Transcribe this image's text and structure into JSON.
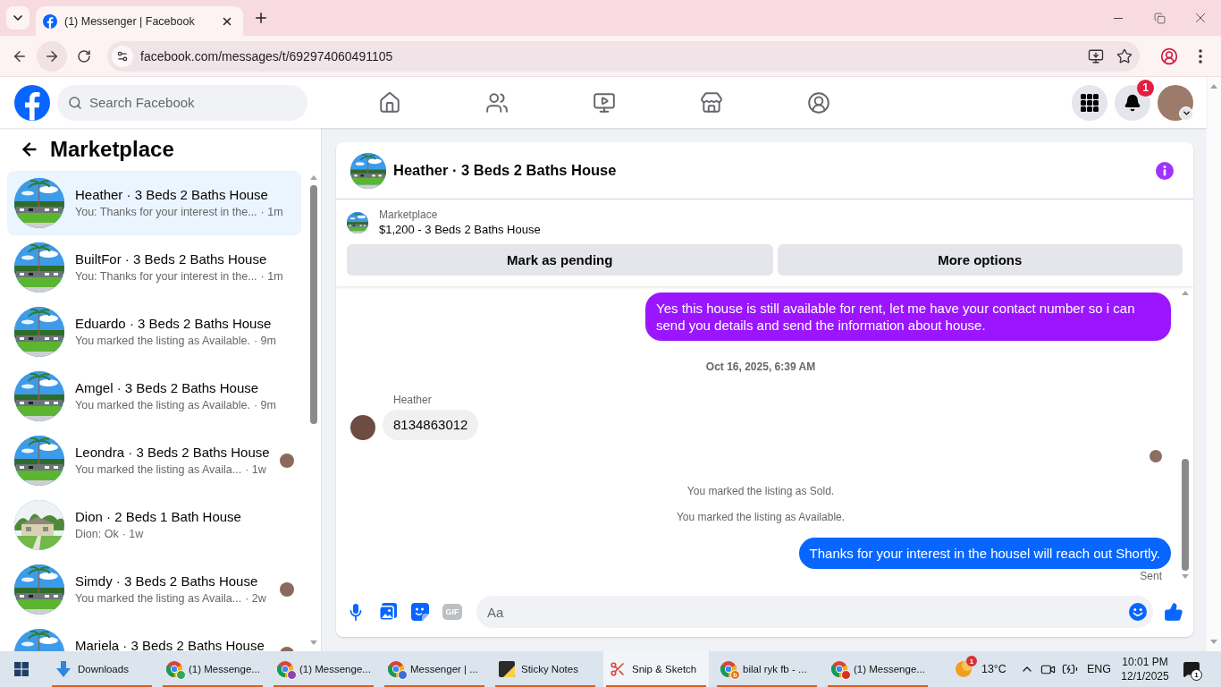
{
  "browser": {
    "tab": {
      "title": "(1) Messenger | Facebook",
      "selected": true
    },
    "address": "facebook.com/messages/t/692974060491105"
  },
  "header": {
    "search": {
      "placeholder": "Search Facebook"
    },
    "nav": [
      {
        "kind": "home",
        "selected": false
      },
      {
        "kind": "friends",
        "selected": false
      },
      {
        "kind": "video",
        "selected": false
      },
      {
        "kind": "marketplace",
        "selected": false
      },
      {
        "kind": "groups",
        "selected": false
      }
    ],
    "notifications_badge": "1"
  },
  "sidebar": {
    "title": "Marketplace",
    "conversations": [
      {
        "kind": "ranch",
        "title": "Heather · 3 Beds 2 Baths House",
        "snippet": "You: Thanks for your interest in the...",
        "time": "· 1m",
        "seen": false,
        "selected": true
      },
      {
        "kind": "ranch",
        "title": "BuiltFor · 3 Beds 2 Baths House",
        "snippet": "You: Thanks for your interest in the...",
        "time": "· 1m",
        "seen": false,
        "selected": false
      },
      {
        "kind": "ranch",
        "title": "Eduardo · 3 Beds 2 Baths House",
        "snippet": "You marked the listing as Available.",
        "time": "· 9m",
        "seen": false,
        "selected": false
      },
      {
        "kind": "ranch",
        "title": "Amgel · 3 Beds 2 Baths House",
        "snippet": "You marked the listing as Available.",
        "time": "· 9m",
        "seen": false,
        "selected": false
      },
      {
        "kind": "ranch",
        "title": "Leondra · 3 Beds 2 Baths House",
        "snippet": "You marked the listing as Availa...",
        "time": "· 1w",
        "seen": true,
        "selected": false
      },
      {
        "kind": "cottage",
        "title": "Dion · 2 Beds 1 Bath House",
        "snippet": "Dion: Ok",
        "time": "· 1w",
        "seen": false,
        "selected": false
      },
      {
        "kind": "ranch",
        "title": "Simdy · 3 Beds 2 Baths House",
        "snippet": "You marked the listing as Availa...",
        "time": "· 2w",
        "seen": true,
        "selected": false
      },
      {
        "kind": "ranch",
        "title": "Mariela · 3 Beds 2 Baths House",
        "seen": true,
        "selected": false
      }
    ]
  },
  "chat": {
    "title": "Heather · 3 Beds 2 Baths House",
    "listing": {
      "source": "Marketplace",
      "summary": "$1,200 - 3 Beds 2 Baths House"
    },
    "actions": [
      {
        "label": "Mark as pending"
      },
      {
        "label": "More options"
      }
    ],
    "messages": [
      {
        "kind": "outgoing",
        "text": "Yes this house is still available for rent, let me have your contact number so i can send you details and send the information about house.",
        "color": "#9b16fe"
      },
      {
        "kind": "timestamp",
        "text": "Oct 16, 2025, 6:39 AM"
      },
      {
        "kind": "incoming",
        "sender": "Heather",
        "text": "8134863012"
      },
      {
        "kind": "read_receipt"
      },
      {
        "kind": "event",
        "text": "You marked the listing as Sold."
      },
      {
        "kind": "event",
        "text": "You marked the listing as Available."
      },
      {
        "kind": "outgoing",
        "text": "Thanks for your interest in the housel will reach out Shortly.",
        "color": "#0866ff",
        "status": "Sent"
      }
    ],
    "composer": {
      "tools": [
        {
          "kind": "mic"
        },
        {
          "kind": "photo"
        },
        {
          "kind": "sticker"
        },
        {
          "kind": "gif",
          "label": "GIF"
        }
      ],
      "placeholder": "Aa"
    }
  },
  "taskbar": {
    "apps": [
      {
        "kind": "downloads",
        "label": "Downloads",
        "selected": false
      },
      {
        "kind": "browser",
        "label": "(1) Messenge...",
        "color": "#34a853",
        "selected": false
      },
      {
        "kind": "browser",
        "label": "(1) Messenge...",
        "color": "#8e44ad",
        "selected": false
      },
      {
        "kind": "browser",
        "label": "Messenger | ...",
        "color": "#3b6fd6",
        "selected": false
      },
      {
        "kind": "sticky_notes",
        "label": "Sticky Notes",
        "selected": false
      },
      {
        "kind": "snip",
        "label": "Snip & Sketch",
        "selected": true
      },
      {
        "kind": "browser",
        "label": "bilal ryk fb - ...",
        "color": "#e8710a",
        "badge": "b",
        "selected": false
      },
      {
        "kind": "browser",
        "label": "(1) Messenge...",
        "color": "#d93025",
        "selected": false
      }
    ],
    "weather": {
      "temperature": "13°C",
      "badge": "1"
    },
    "language": "ENG",
    "time": "10:01 PM",
    "date": "12/1/2025",
    "notifications_badge": "1"
  }
}
